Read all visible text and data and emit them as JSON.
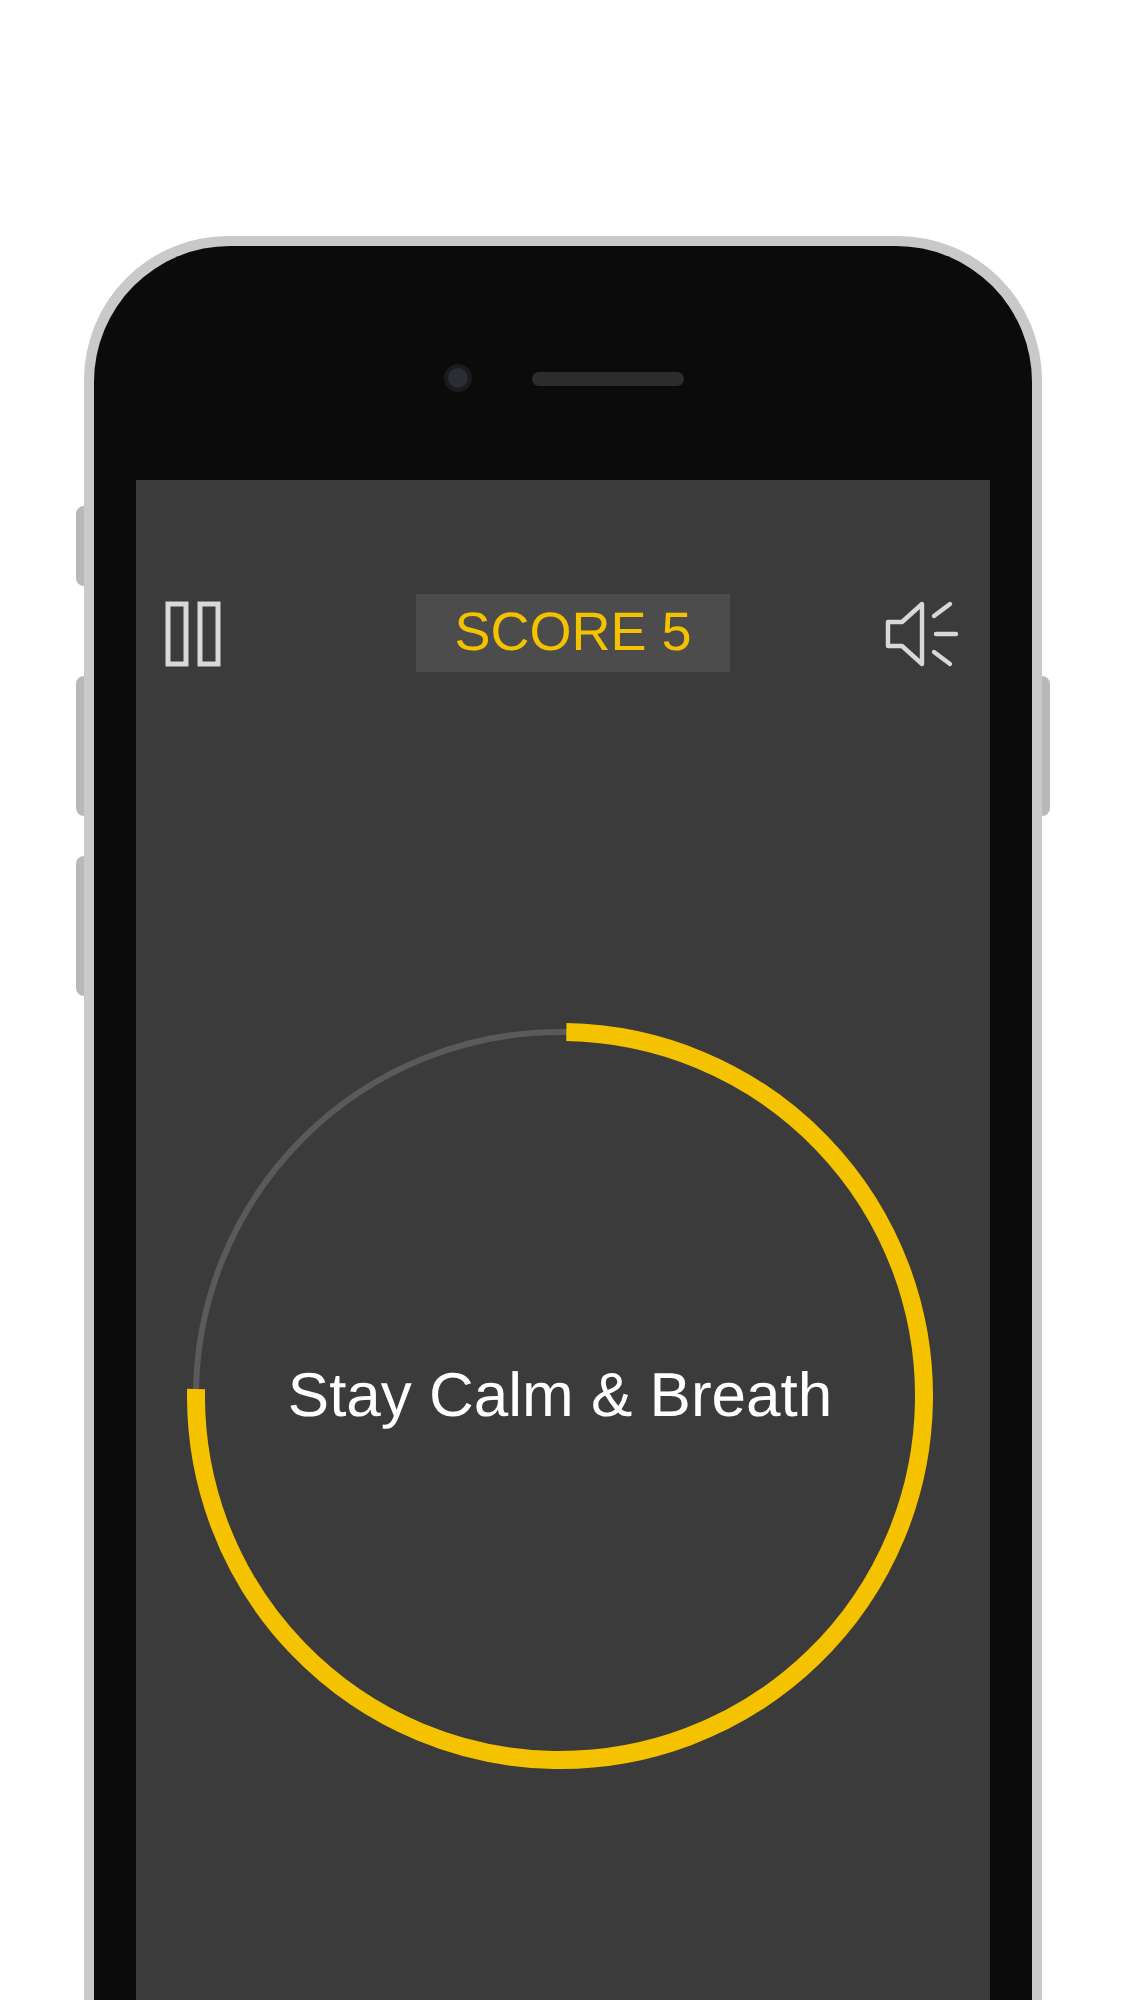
{
  "score": {
    "label": "SCORE 5"
  },
  "breath_ring": {
    "level": 0.75
  },
  "message": "Stay Calm & Breath"
}
